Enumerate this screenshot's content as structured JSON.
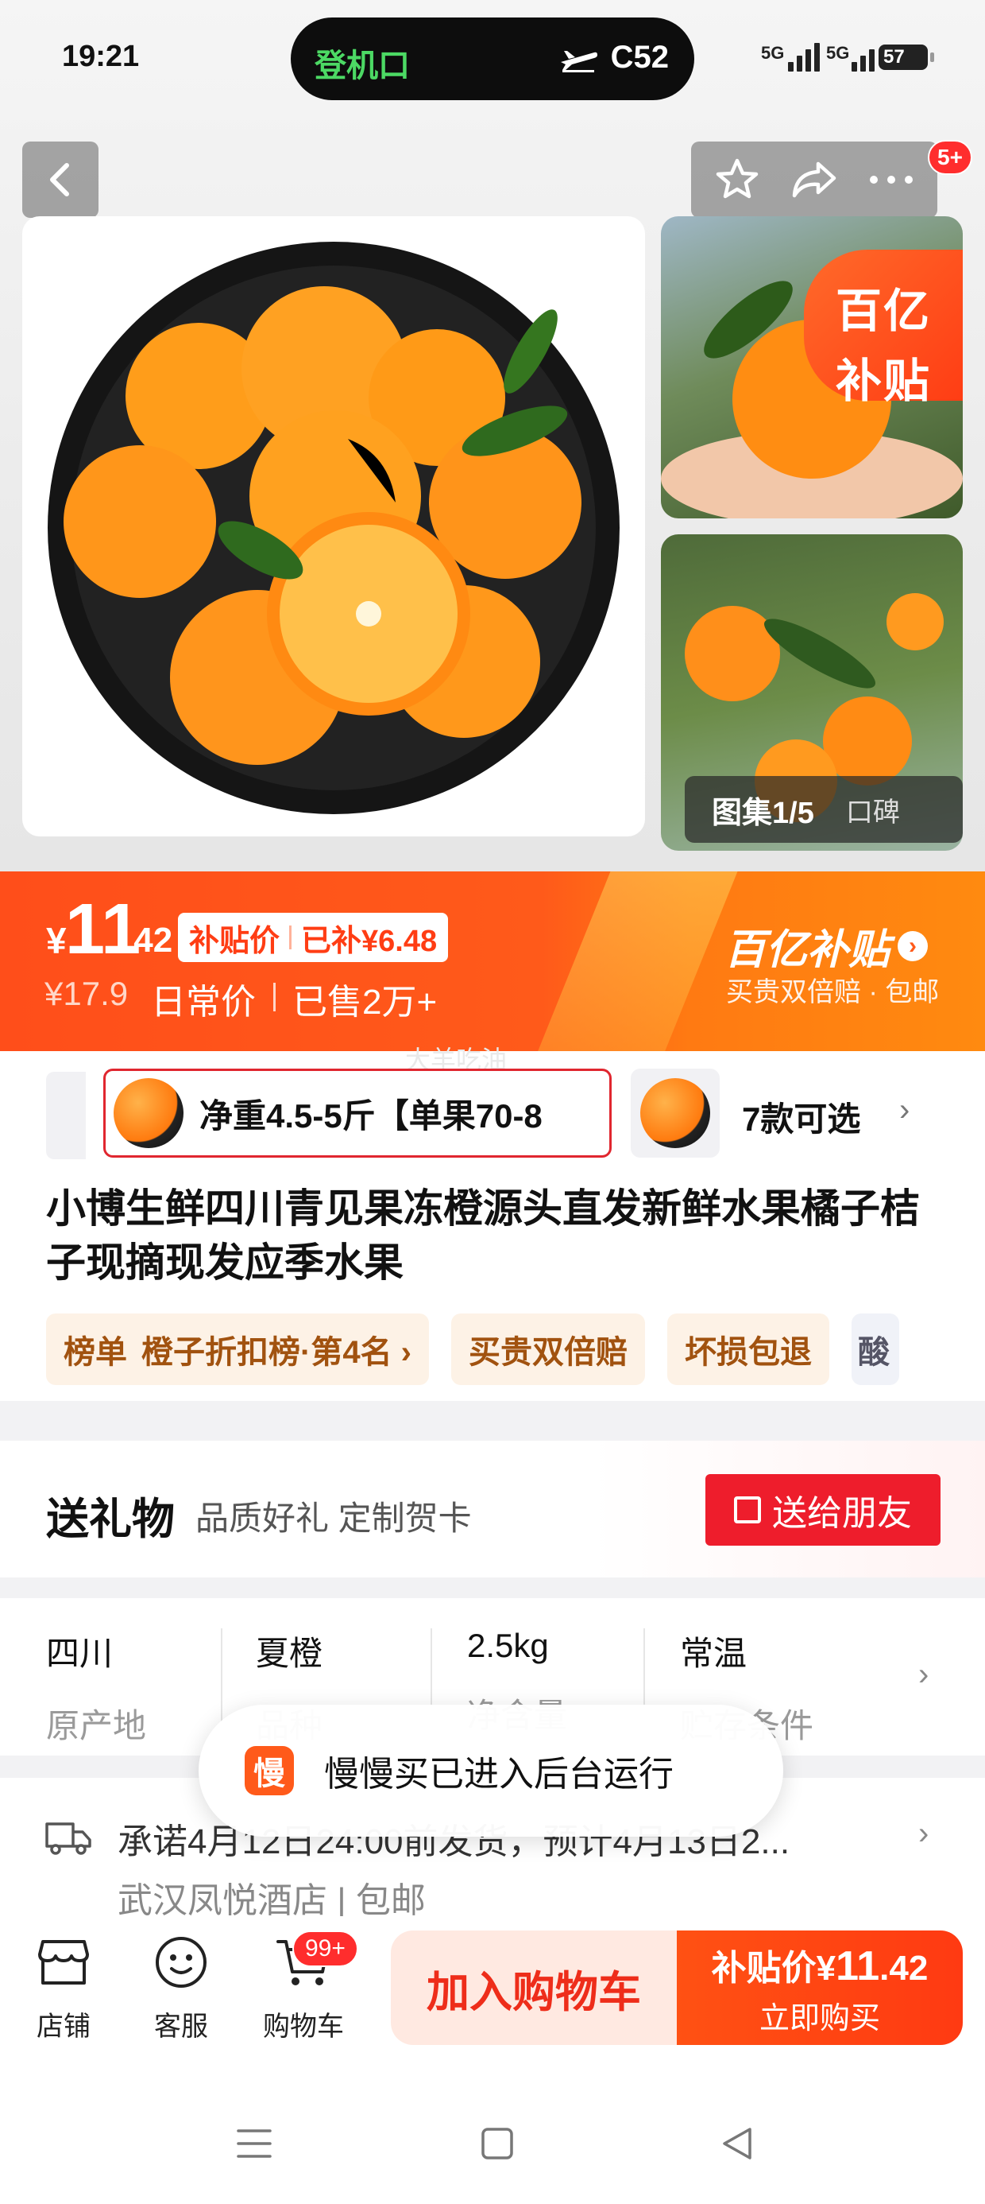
{
  "status_bar": {
    "time": "19:21",
    "island_left": "登机口",
    "island_right": "C52",
    "signal1": "5G",
    "signal2": "5G",
    "battery": "57"
  },
  "gallery": {
    "subsidy_line1": "百亿",
    "subsidy_line2": "补贴",
    "counter": "图集1/5",
    "review_tab": "口碑",
    "more_badge": "5+"
  },
  "price": {
    "symbol": "¥",
    "integer": "11",
    "decimal": ".42",
    "tag_label": "补贴价",
    "tag_subsidy": "已补¥6.48",
    "original": "¥17.9",
    "daily_label": "日常价",
    "sold": "已售2万+",
    "brand": "百亿补贴",
    "brand_sub": "买贵双倍赔 · 包邮"
  },
  "watermark": "大羊吃油",
  "sku": {
    "selected": "净重4.5-5斤【单果70-8",
    "count": "7款可选"
  },
  "product": {
    "title": "小博生鲜四川青见果冻橙源头直发新鲜水果橘子桔子现摘现发应季水果"
  },
  "tags": [
    {
      "key": "榜单",
      "value": "橙子折扣榜·第4名 ›"
    },
    {
      "key": "",
      "value": "买贵双倍赔"
    },
    {
      "key": "",
      "value": "坏损包退"
    },
    {
      "key": "",
      "value": "酸"
    }
  ],
  "gift": {
    "heading": "送礼物",
    "sub": "品质好礼 定制贺卡",
    "button": "送给朋友"
  },
  "attributes": [
    {
      "value": "四川",
      "key": "原产地"
    },
    {
      "value": "夏橙",
      "key": "品种"
    },
    {
      "value": "2.5kg",
      "key": "净含量"
    },
    {
      "value": "常温",
      "key": "贮存条件"
    }
  ],
  "shipping": {
    "line1": "承诺4月12日24:00前发货，预计4月13日2...",
    "line2": "武汉凤悦酒店 | 包邮"
  },
  "toast": {
    "icon_char": "慢",
    "text": "慢慢买已进入后台运行"
  },
  "actionbar": {
    "shop": "店铺",
    "service": "客服",
    "cart": "购物车",
    "cart_badge": "99+",
    "add_to_cart": "加入购物车",
    "buy_label": "补贴价",
    "buy_symbol": "¥",
    "buy_price": "11",
    "buy_decimal": ".42",
    "buy_now": "立即购买"
  },
  "colors": {
    "accent": "#ff4e1a",
    "red_button": "#ee1d2c"
  }
}
